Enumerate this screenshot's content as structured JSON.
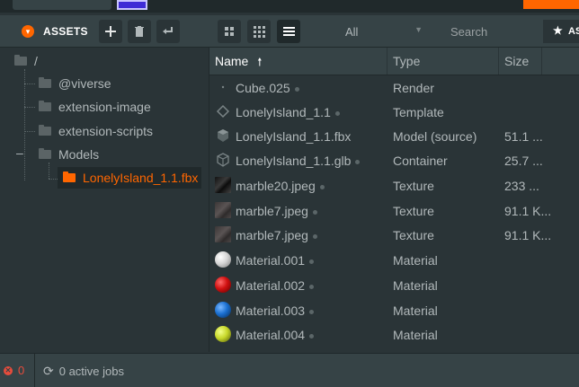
{
  "header": {
    "title": "ASSETS",
    "filter_value": "All",
    "search_placeholder": "Search",
    "star_label": "AS"
  },
  "tree": {
    "root": "/",
    "items": [
      {
        "label": "@viverse"
      },
      {
        "label": "extension-image"
      },
      {
        "label": "extension-scripts"
      },
      {
        "label": "Models"
      },
      {
        "label": "LonelyIsland_1.1.fbx"
      }
    ]
  },
  "grid": {
    "columns": {
      "name": "Name",
      "type": "Type",
      "size": "Size"
    },
    "rows": [
      {
        "name": "Cube.025",
        "type": "Render",
        "size": "",
        "icon": "render-icon"
      },
      {
        "name": "LonelyIsland_1.1",
        "type": "Template",
        "size": "",
        "icon": "template-icon"
      },
      {
        "name": "LonelyIsland_1.1.fbx",
        "type": "Model (source)",
        "size": "51.1 ...",
        "icon": "model-icon"
      },
      {
        "name": "LonelyIsland_1.1.glb",
        "type": "Container",
        "size": "25.7 ...",
        "icon": "container-icon"
      },
      {
        "name": "marble20.jpeg",
        "type": "Texture",
        "size": "233 ...",
        "icon": "texture-thumbnail",
        "color": "#1c1c1c"
      },
      {
        "name": "marble7.jpeg",
        "type": "Texture",
        "size": "91.1 K...",
        "icon": "texture-thumbnail",
        "color": "#4a4646"
      },
      {
        "name": "marble7.jpeg",
        "type": "Texture",
        "size": "91.1 K...",
        "icon": "texture-thumbnail",
        "color": "#4a4646"
      },
      {
        "name": "Material.001",
        "type": "Material",
        "size": "",
        "icon": "material-sphere",
        "color": "#e8e8e8"
      },
      {
        "name": "Material.002",
        "type": "Material",
        "size": "",
        "icon": "material-sphere",
        "color": "#d01010"
      },
      {
        "name": "Material.003",
        "type": "Material",
        "size": "",
        "icon": "material-sphere",
        "color": "#1a6fd0"
      },
      {
        "name": "Material.004",
        "type": "Material",
        "size": "",
        "icon": "material-sphere",
        "color": "#c8d82a"
      }
    ]
  },
  "status": {
    "error_count": "0",
    "jobs_label": "0 active jobs"
  },
  "colors": {
    "accent": "#ff6600",
    "panel": "#2a3437",
    "header": "#364346",
    "text": "#b1b8ba"
  }
}
